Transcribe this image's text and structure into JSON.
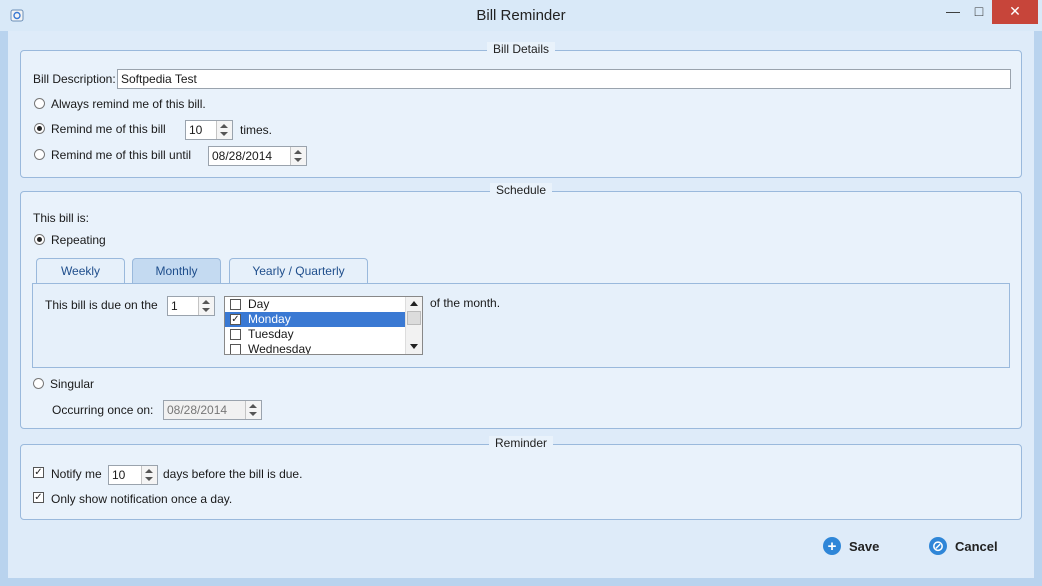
{
  "window": {
    "title": "Bill Reminder",
    "minimize_glyph": "—",
    "maximize_glyph": "□",
    "close_glyph": "✕"
  },
  "bill_details": {
    "title": "Bill Details",
    "description_label": "Bill Description:",
    "description_value": "Softpedia Test",
    "always_label": "Always remind me of this bill.",
    "remind_times_label": "Remind me of this bill",
    "times_value": "10",
    "times_suffix": "times.",
    "remind_until_label": "Remind me of this bill until",
    "until_date": "08/28/2014"
  },
  "schedule": {
    "title": "Schedule",
    "this_bill_is": "This bill is:",
    "repeating_label": "Repeating",
    "tabs": [
      {
        "label": "Weekly"
      },
      {
        "label": "Monthly"
      },
      {
        "label": "Yearly / Quarterly"
      }
    ],
    "due_label": "This bill is due on the",
    "due_value": "1",
    "days": [
      {
        "label": "Day",
        "checked": false
      },
      {
        "label": "Monday",
        "checked": true
      },
      {
        "label": "Tuesday",
        "checked": false
      },
      {
        "label": "Wednesday",
        "checked": false
      }
    ],
    "of_month": "of the month.",
    "singular_label": "Singular",
    "occurring_label": "Occurring once on:",
    "occurring_date": "08/28/2014"
  },
  "reminder": {
    "title": "Reminder",
    "notify_label": "Notify me",
    "notify_value": "10",
    "notify_suffix": "days before the bill is due.",
    "once_label": "Only show notification once a day."
  },
  "buttons": {
    "save": "Save",
    "cancel": "Cancel"
  },
  "colors": {
    "accent": "#2f86d8",
    "close_button": "#c7453a",
    "selection": "#3a79d3"
  }
}
